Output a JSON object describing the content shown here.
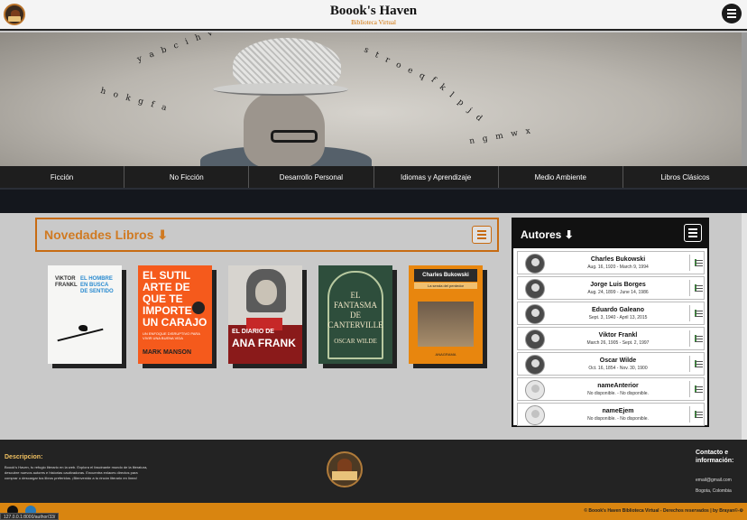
{
  "header": {
    "title": "Boook's Haven",
    "subtitle": "Biblioteca Virtual"
  },
  "banner": {
    "scatter_letters": [
      "y a b c i h v",
      "s t r o e q",
      "f k l p j d",
      "n g m w x",
      "h o k g f a"
    ]
  },
  "categories": [
    "Ficción",
    "No Ficción",
    "Desarrollo Personal",
    "Idiomas y Aprendizaje",
    "Medio Ambiente",
    "Libros Clásicos"
  ],
  "novedades": {
    "title": "Novedades Libros ⬇"
  },
  "books": [
    {
      "author": "VIKTOR\nFRANKL",
      "title": "EL HOMBRE\nEN BUSCA\nDE SENTIDO"
    },
    {
      "title": "EL SUTIL\nARTE DE\nQUE TE\nIMPORTE\nUN CARAJO",
      "subtitle": "UN ENFOQUE DISRUPTIVO PARA VIVIR UNA BUENA VIDA",
      "author": "MARK MANSON"
    },
    {
      "title_top": "EL DIARIO DE",
      "title_main": "ANA FRANK"
    },
    {
      "title": "EL\nFANTASMA\nDE\nCANTERVILLE",
      "author": "OSCAR WILDE"
    },
    {
      "author": "Charles Bukowski",
      "subtitle": "La senda del perdedor",
      "publisher": "ANAGRAMA"
    }
  ],
  "autores": {
    "title": "Autores ⬇",
    "items": [
      {
        "name": "Charles Bukowski",
        "dates": "Aug. 16, 1920 - March 9, 1994",
        "has_photo": true
      },
      {
        "name": "Jorge Luis Borges",
        "dates": "Aug. 24, 1899 - June 14, 1986",
        "has_photo": true
      },
      {
        "name": "Eduardo Galeano",
        "dates": "Sept. 3, 1940 - April 13, 2015",
        "has_photo": true
      },
      {
        "name": "Viktor Frankl",
        "dates": "March 26, 1905 - Sept. 2, 1997",
        "has_photo": true
      },
      {
        "name": "Oscar Wilde",
        "dates": "Oct. 16, 1854 - Nov. 30, 1900",
        "has_photo": true
      },
      {
        "name": "nameAnterior",
        "dates": "No disponible. - No disponible.",
        "has_photo": false
      },
      {
        "name": "nameEjem",
        "dates": "No disponible. - No disponible.",
        "has_photo": false
      }
    ]
  },
  "footer": {
    "desc_heading": "Descripcion:",
    "desc_text": "Boook's Haven, tu refugio literario en la web. Explora el fascinante mundo de la literatura, descubre nuevos autores e historias cautivadoras. Encuentra enlaces directos para comprar o descargar tus libros preferidos. ¡Bienvenido a tu rincón literario en línea!",
    "contact_heading": "Contacto e información:",
    "email": "email@gmail.com",
    "location": "Bogota, Colombia",
    "copyright": "© Boook's Haven Biblioteca Virtual - Derechos reservados | by Brayan©-⚙",
    "status_url": "127.0.0.1:8000/author/33/"
  },
  "colors": {
    "accent": "#d07a22",
    "dark": "#1e1e1e",
    "footer_bar": "#d98510"
  }
}
